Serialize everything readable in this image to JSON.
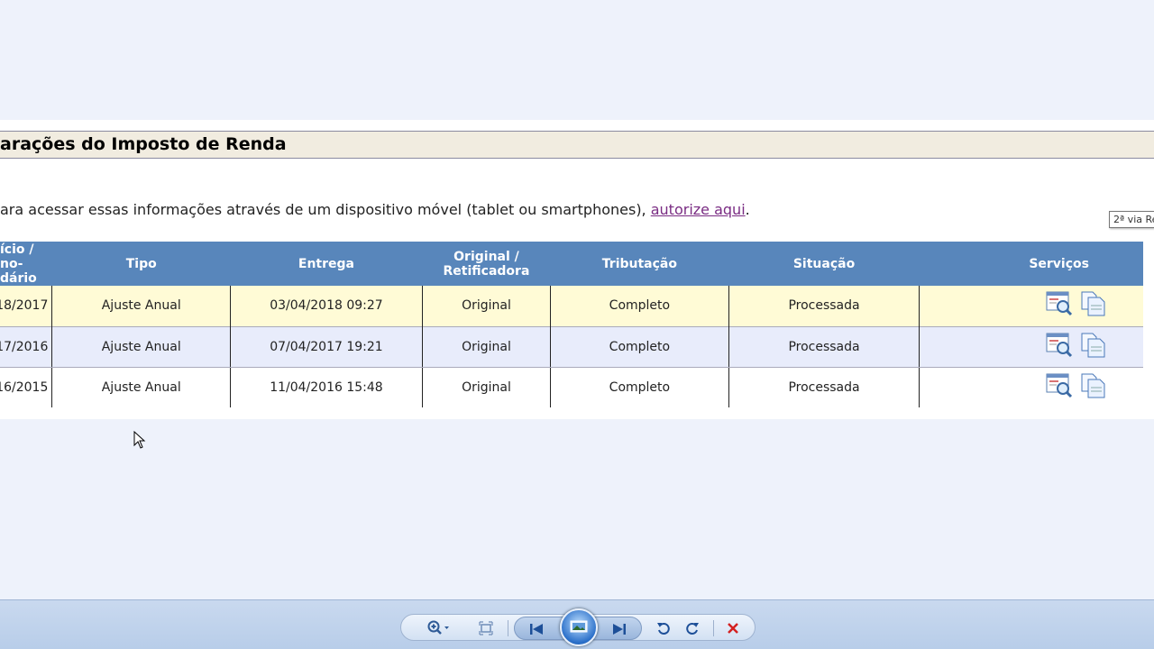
{
  "page": {
    "title": "arações do Imposto de Renda",
    "info_text": "ara acessar essas informações através de um dispositivo móvel (tablet ou smartphones), ",
    "info_link": "autorize aqui",
    "info_end": "."
  },
  "table": {
    "headers": {
      "col1_line1": "ício /",
      "col1_line2": "no-",
      "col1_line3": "dário",
      "tipo": "Tipo",
      "entrega": "Entrega",
      "original_line1": "Original /",
      "original_line2": "Retificadora",
      "tributacao": "Tributação",
      "situacao": "Situação",
      "servicos": "Serviços"
    },
    "rows": [
      {
        "exercicio": "18/2017",
        "tipo": "Ajuste Anual",
        "entrega": "03/04/2018 09:27",
        "original": "Original",
        "tributacao": "Completo",
        "situacao": "Processada"
      },
      {
        "exercicio": "17/2016",
        "tipo": "Ajuste Anual",
        "entrega": "07/04/2017 19:21",
        "original": "Original",
        "tributacao": "Completo",
        "situacao": "Processada"
      },
      {
        "exercicio": "16/2015",
        "tipo": "Ajuste Anual",
        "entrega": "11/04/2016 15:48",
        "original": "Original",
        "tributacao": "Completo",
        "situacao": "Processada"
      }
    ],
    "service_icons": [
      "view-document-icon",
      "copy-document-icon"
    ]
  },
  "tooltip": "2ª via Re",
  "toolbar": {
    "icons": [
      "zoom-icon",
      "actual-size-icon",
      "previous-icon",
      "slideshow-icon",
      "next-icon",
      "rotate-left-icon",
      "rotate-right-icon",
      "delete-icon"
    ]
  },
  "colors": {
    "header_blue": "#5886bb",
    "row_highlight": "#fffbd6",
    "row_alt": "#e8ecfb",
    "link": "#7a2c83",
    "title_bg": "#f1ece0",
    "viewer_bg": "#eef2fb"
  }
}
